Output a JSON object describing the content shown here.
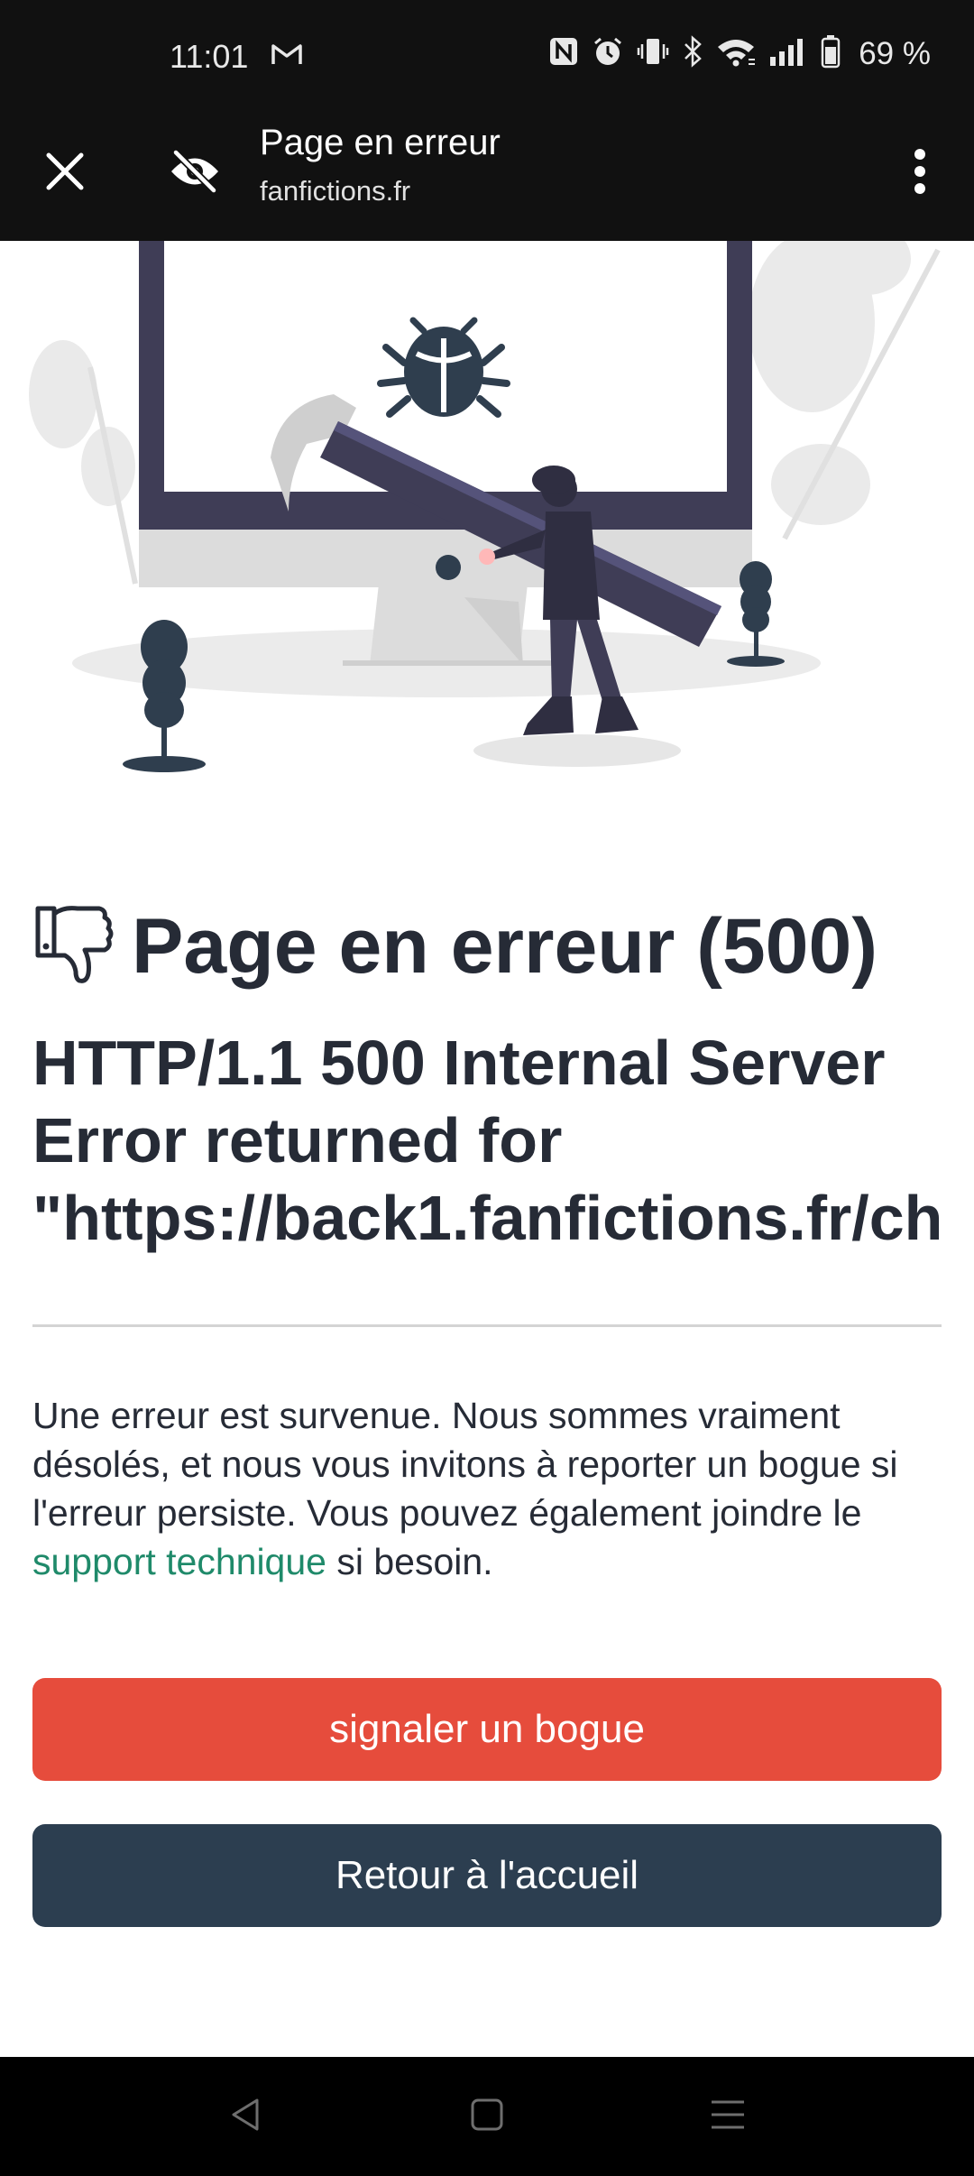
{
  "status_bar": {
    "time": "11:01",
    "battery_percent": "69 %",
    "icons": [
      "gmail-icon",
      "nfc-icon",
      "alarm-icon",
      "vibrate-icon",
      "bluetooth-icon",
      "wifi-icon",
      "signal-icon",
      "battery-icon"
    ]
  },
  "toolbar": {
    "title": "Page en erreur",
    "domain": "fanfictions.fr",
    "close_icon": "close-icon",
    "privacy_icon": "eye-off-icon",
    "menu_icon": "more-vert-icon"
  },
  "error": {
    "heading": "Page en erreur (500)",
    "heading_icon": "thumbs-down-icon",
    "subheading_line1": "HTTP/1.1 500 Internal Server",
    "subheading_line2": "Error returned for",
    "subheading_line3": "\"https://back1.fanfictions.fr/ch",
    "description_before": "Une erreur est survenue. Nous sommes vraiment désolés, et nous vous invitons à reporter un bogue si l'erreur persiste. Vous pouvez également joindre le ",
    "description_link": "support technique",
    "description_after": " si besoin."
  },
  "buttons": {
    "report_bug": "signaler un bogue",
    "home": "Retour à l'accueil"
  },
  "colors": {
    "report_button": "#e64c3c",
    "home_button": "#2c3e50",
    "link": "#1f8a6a",
    "heading": "#262b36"
  },
  "nav_bar": {
    "icons": [
      "back-icon",
      "home-icon",
      "recents-icon"
    ]
  }
}
